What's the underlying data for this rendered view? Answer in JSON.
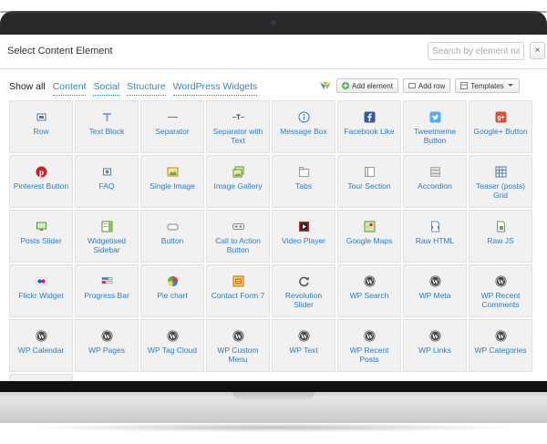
{
  "dialog": {
    "title": "Select Content Element",
    "search_placeholder": "Search by element name",
    "close_label": "×"
  },
  "tabs": [
    "Show all",
    "Content",
    "Social",
    "Structure",
    "WordPress Widgets"
  ],
  "toolbar": {
    "add_element": "Add element",
    "add_row": "Add row",
    "templates": "Templates"
  },
  "colors": {
    "link": "#2e7bbf",
    "cell_bg": "#f1f1f1",
    "bezel": "#1c1c1e"
  },
  "elements": [
    {
      "label": "Row",
      "icon": "row-icon"
    },
    {
      "label": "Text Block",
      "icon": "text-block-icon"
    },
    {
      "label": "Separator",
      "icon": "separator-icon"
    },
    {
      "label": "Separator with Text",
      "icon": "separator-text-icon"
    },
    {
      "label": "Message Box",
      "icon": "info-icon"
    },
    {
      "label": "Facebook Like",
      "icon": "facebook-icon"
    },
    {
      "label": "Tweetmeme Button",
      "icon": "twitter-icon"
    },
    {
      "label": "Google+ Button",
      "icon": "google-plus-icon"
    },
    {
      "label": "Pinterest Button",
      "icon": "pinterest-icon"
    },
    {
      "label": "FAQ",
      "icon": "faq-icon"
    },
    {
      "label": "Single Image",
      "icon": "image-icon"
    },
    {
      "label": "Image Gallery",
      "icon": "gallery-icon"
    },
    {
      "label": "Tabs",
      "icon": "tabs-icon"
    },
    {
      "label": "Tour Section",
      "icon": "tour-icon"
    },
    {
      "label": "Accordion",
      "icon": "accordion-icon"
    },
    {
      "label": "Teaser (posts) Grid",
      "icon": "teaser-grid-icon"
    },
    {
      "label": "Posts Slider",
      "icon": "posts-slider-icon"
    },
    {
      "label": "Widgetised Sidebar",
      "icon": "sidebar-icon"
    },
    {
      "label": "Button",
      "icon": "button-icon"
    },
    {
      "label": "Call to Action Button",
      "icon": "cta-icon"
    },
    {
      "label": "Video Player",
      "icon": "video-icon"
    },
    {
      "label": "Google Maps",
      "icon": "maps-icon"
    },
    {
      "label": "Raw HTML",
      "icon": "raw-html-icon"
    },
    {
      "label": "Raw JS",
      "icon": "raw-js-icon"
    },
    {
      "label": "Flickr Widget",
      "icon": "flickr-icon"
    },
    {
      "label": "Progress Bar",
      "icon": "progress-bar-icon"
    },
    {
      "label": "Pie chart",
      "icon": "pie-chart-icon"
    },
    {
      "label": "Contact Form 7",
      "icon": "contact-form-icon"
    },
    {
      "label": "Revolution Slider",
      "icon": "revolution-icon"
    },
    {
      "label": "WP Search",
      "icon": "wordpress-icon"
    },
    {
      "label": "WP Meta",
      "icon": "wordpress-icon"
    },
    {
      "label": "WP Recent Comments",
      "icon": "wordpress-icon"
    },
    {
      "label": "WP Calendar",
      "icon": "wordpress-icon"
    },
    {
      "label": "WP Pages",
      "icon": "wordpress-icon"
    },
    {
      "label": "WP Tag Cloud",
      "icon": "wordpress-icon"
    },
    {
      "label": "WP Custom Menu",
      "icon": "wordpress-icon"
    },
    {
      "label": "WP Text",
      "icon": "wordpress-icon"
    },
    {
      "label": "WP Recent Posts",
      "icon": "wordpress-icon"
    },
    {
      "label": "WP Links",
      "icon": "wordpress-icon"
    },
    {
      "label": "WP Categories",
      "icon": "wordpress-icon"
    }
  ]
}
